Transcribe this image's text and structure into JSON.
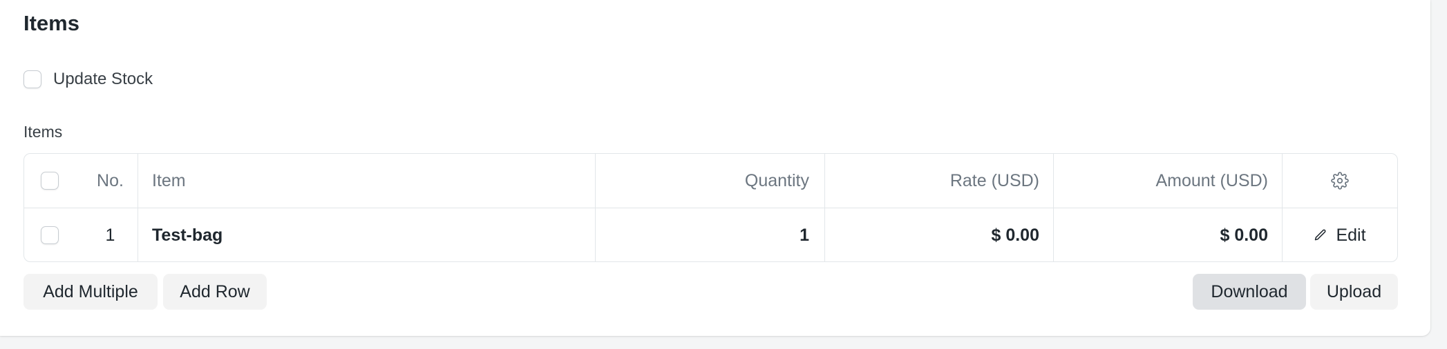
{
  "section": {
    "title": "Items"
  },
  "update_stock": {
    "label": "Update Stock",
    "checked": false
  },
  "items_table": {
    "label": "Items",
    "columns": [
      "No.",
      "Item",
      "Quantity",
      "Rate (USD)",
      "Amount (USD)"
    ],
    "settings_icon": "gear-icon",
    "rows": [
      {
        "no": "1",
        "item": "Test-bag",
        "quantity": "1",
        "rate": "$ 0.00",
        "amount": "$ 0.00",
        "edit_label": "Edit",
        "edit_icon": "pencil-icon"
      }
    ]
  },
  "actions": {
    "add_multiple": "Add Multiple",
    "add_row": "Add Row",
    "download": "Download",
    "upload": "Upload"
  },
  "colors": {
    "border": "#e2e6e9",
    "header_text": "#6c7680",
    "button_bg": "#f3f3f3",
    "button_active_bg": "#dfe1e4"
  }
}
